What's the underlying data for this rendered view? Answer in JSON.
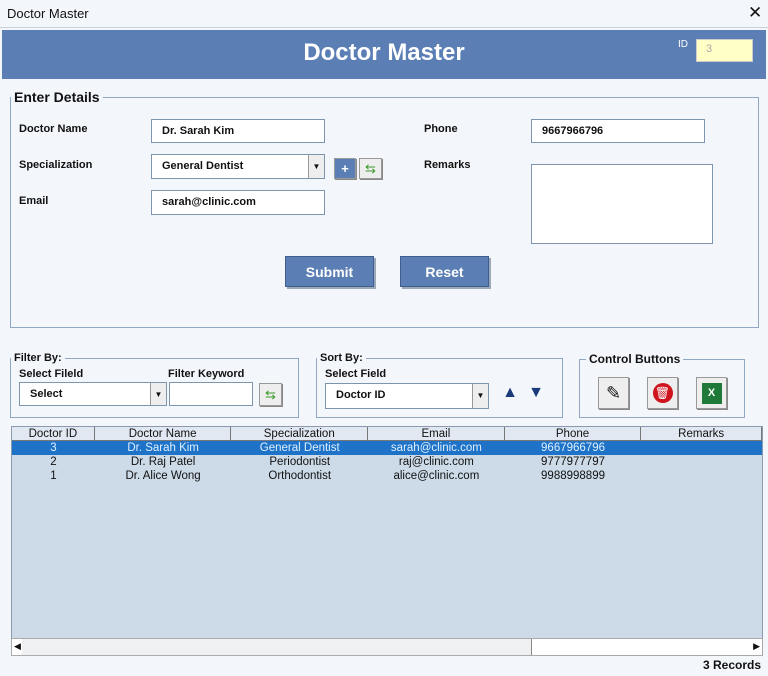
{
  "window": {
    "title": "Doctor Master",
    "close": "✕"
  },
  "header": {
    "title": "Doctor Master",
    "id_label": "ID",
    "id_value": "3"
  },
  "details": {
    "legend": "Enter Details",
    "doctor_name_label": "Doctor Name",
    "doctor_name": "Dr. Sarah Kim",
    "specialization_label": "Specialization",
    "specialization": "General Dentist",
    "email_label": "Email",
    "email": "sarah@clinic.com",
    "phone_label": "Phone",
    "phone": "9667966796",
    "remarks_label": "Remarks",
    "remarks": "",
    "add_symbol": "+",
    "submit": "Submit",
    "reset": "Reset"
  },
  "filter": {
    "legend": "Filter By:",
    "field_label": "Select Fileld",
    "field_value": "Select",
    "keyword_label": "Filter Keyword",
    "keyword": ""
  },
  "sort": {
    "legend": "Sort By:",
    "field_label": "Select Field",
    "field_value": "Doctor ID"
  },
  "control": {
    "legend": "Control Buttons"
  },
  "table": {
    "columns": [
      "Doctor ID",
      "Doctor Name",
      "Specialization",
      "Email",
      "Phone",
      "Remarks"
    ],
    "rows": [
      [
        "3",
        "Dr. Sarah Kim",
        "General Dentist",
        "sarah@clinic.com",
        "9667966796",
        ""
      ],
      [
        "2",
        "Dr. Raj Patel",
        "Periodontist",
        "raj@clinic.com",
        "9777977797",
        ""
      ],
      [
        "1",
        "Dr. Alice Wong",
        "Orthodontist",
        "alice@clinic.com",
        "9988998899",
        ""
      ]
    ]
  },
  "status": {
    "records": "3 Records"
  }
}
